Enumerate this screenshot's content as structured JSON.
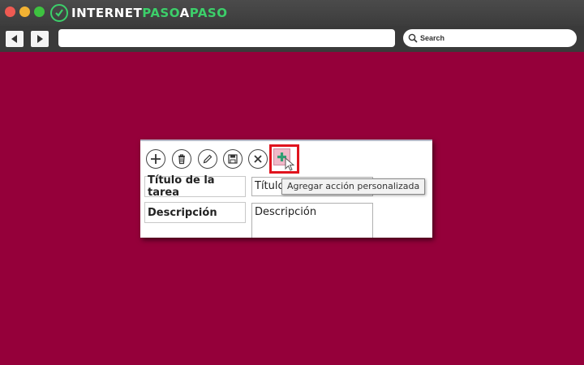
{
  "browser": {
    "logo": {
      "part1": "INTERNET",
      "part2": "PASO",
      "part3": "A",
      "part4": "PASO"
    },
    "search": {
      "placeholder": "Search"
    },
    "colors": {
      "background": "#95003a",
      "logo_accent": "#3ccf6a"
    }
  },
  "panel": {
    "toolbar": {
      "icons": [
        "add-icon",
        "trash-icon",
        "pencil-icon",
        "save-icon",
        "close-icon",
        "custom-action-plus-icon"
      ]
    },
    "form": {
      "title_label": "Título de la tarea",
      "title_value": "Título",
      "description_label": "Descripción",
      "description_value": "Descripción"
    },
    "tooltip": "Agregar acción personalizada",
    "colors": {
      "highlight": "#e0141e"
    }
  }
}
